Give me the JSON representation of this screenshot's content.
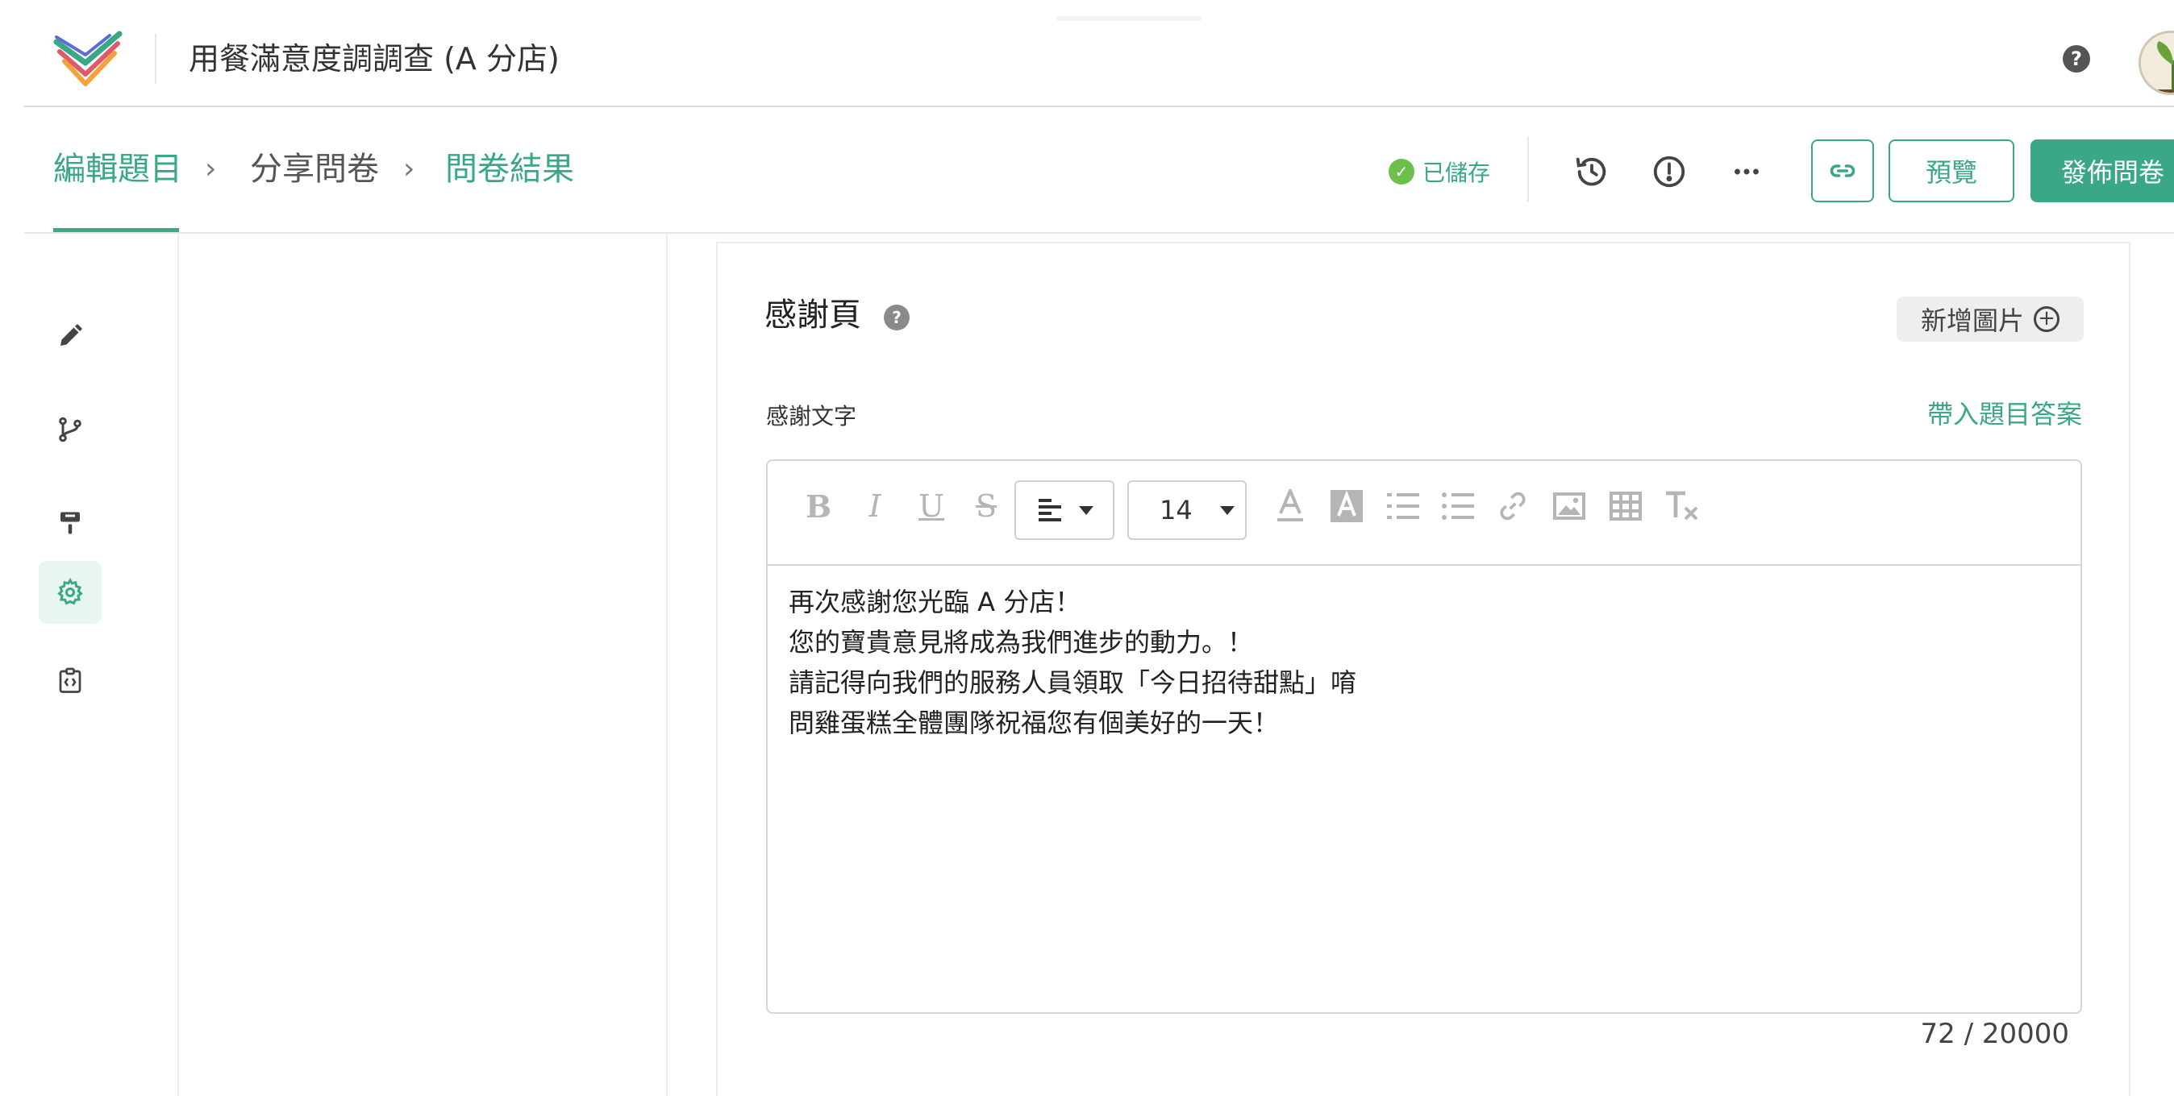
{
  "header": {
    "title": "用餐滿意度調調查 (A 分店)",
    "help_icon": "help-circle-icon",
    "help_glyph": "?"
  },
  "colors": {
    "accent": "#3aa887",
    "saved_check": "#6cc04a"
  },
  "breadcrumb": {
    "items": [
      {
        "label": "編輯題目",
        "state": "active"
      },
      {
        "label": "分享問卷",
        "state": "default"
      },
      {
        "label": "問卷結果",
        "state": "default"
      }
    ],
    "separator": "›"
  },
  "status": {
    "saved_label": "已儲存",
    "saved_glyph": "✓"
  },
  "actions": {
    "history_icon": "history-icon",
    "warning_icon": "alert-circle-icon",
    "more_icon": "more-horizontal-icon",
    "link_icon": "link-icon",
    "preview_label": "預覽",
    "publish_label": "發佈問卷"
  },
  "rail": {
    "items": [
      {
        "icon": "pencil-icon",
        "active": false
      },
      {
        "icon": "branch-icon",
        "active": false
      },
      {
        "icon": "paint-roller-icon",
        "active": false
      },
      {
        "icon": "gear-icon",
        "active": true
      },
      {
        "icon": "code-clipboard-icon",
        "active": false
      }
    ]
  },
  "card": {
    "title": "感謝頁",
    "help_glyph": "?",
    "add_image_label": "新增圖片",
    "add_image_glyph": "+",
    "field_label": "感謝文字",
    "insert_answer_label": "帶入題目答案"
  },
  "editor": {
    "toolbar": {
      "bold": "B",
      "italic": "I",
      "underline": "U",
      "strike": "S",
      "align_icon": "align-left-icon",
      "font_size": "14"
    },
    "lines": [
      "再次感謝您光臨 A 分店！",
      "您的寶貴意見將成為我們進步的動力。！",
      "請記得向我們的服務人員領取「今日招待甜點」唷",
      "問雞蛋糕全體團隊祝福您有個美好的一天！"
    ],
    "char_count": "72 / 20000"
  }
}
